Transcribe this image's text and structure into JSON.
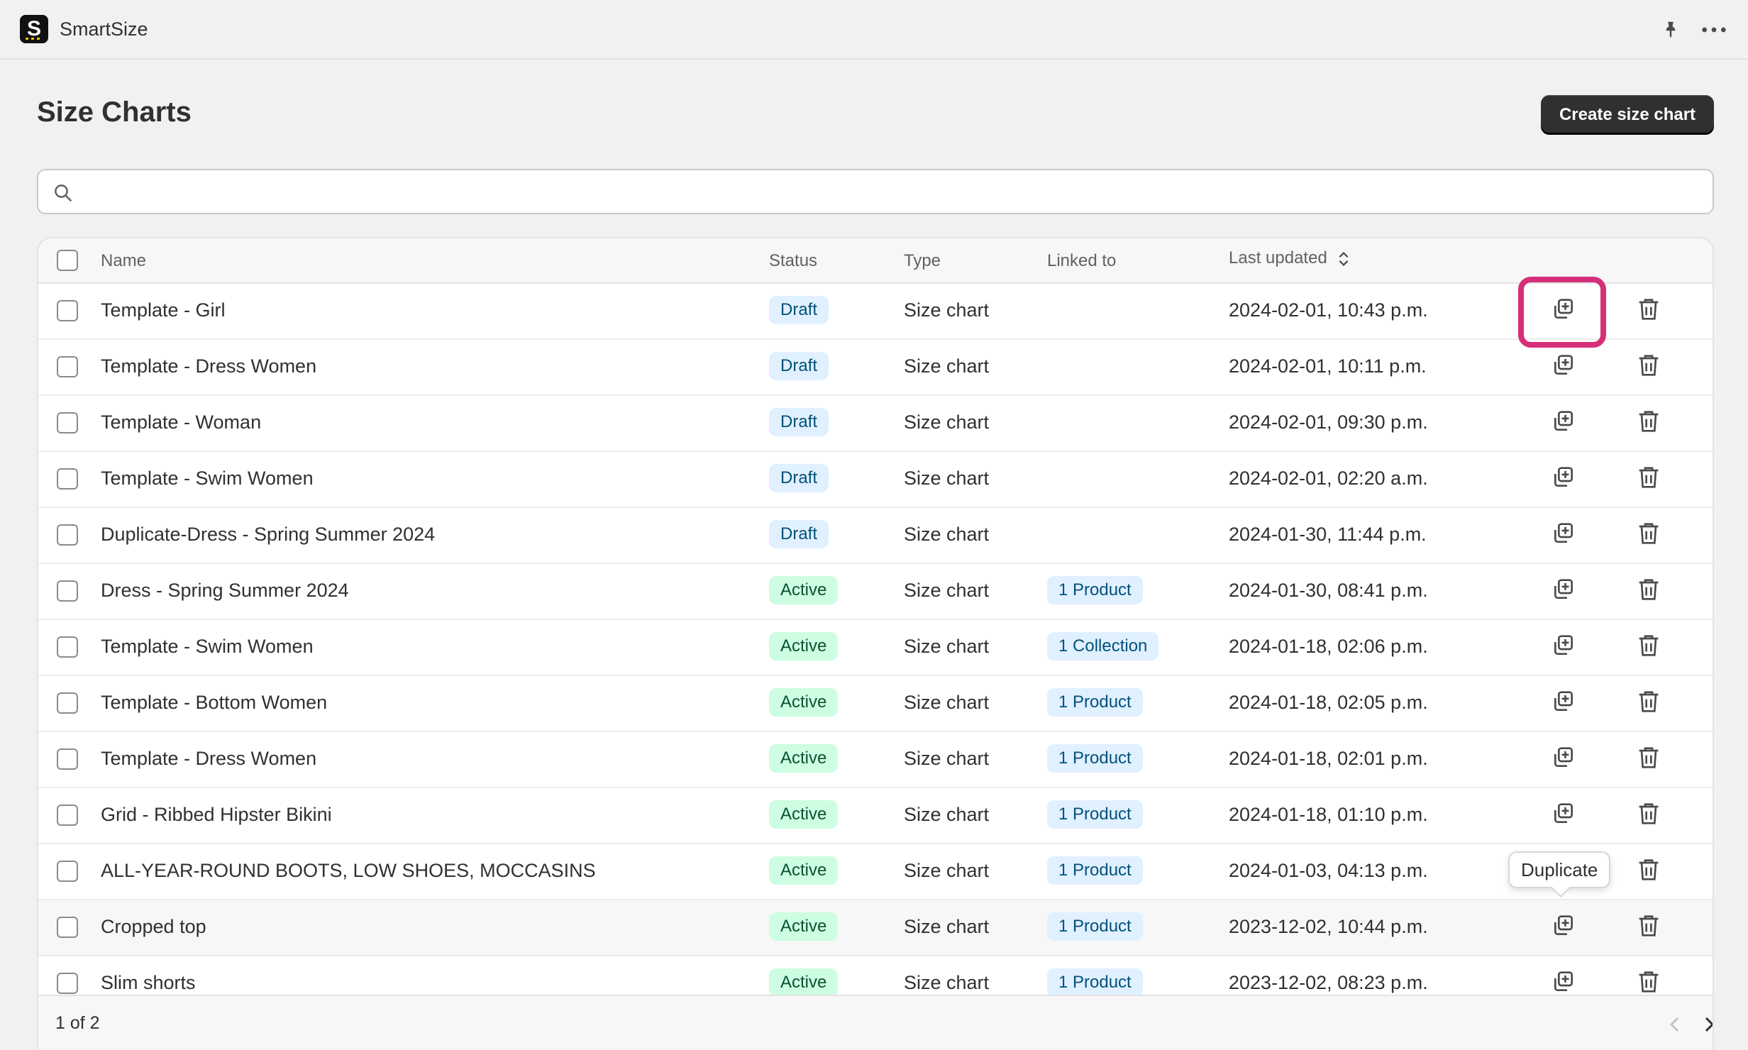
{
  "app": {
    "name": "SmartSize",
    "logo_letter": "S"
  },
  "topbar": {
    "pin_icon": "pin-icon",
    "more_icon": "more-horizontal-icon"
  },
  "page": {
    "title": "Size Charts",
    "create_button": "Create size chart"
  },
  "search": {
    "placeholder": "",
    "value": ""
  },
  "table": {
    "columns": {
      "name": "Name",
      "status": "Status",
      "type": "Type",
      "linked": "Linked to",
      "updated": "Last updated"
    },
    "rows": [
      {
        "name": "Template - Girl",
        "status": "Draft",
        "type": "Size chart",
        "linked": "",
        "updated": "2024-02-01, 10:43 p.m."
      },
      {
        "name": "Template - Dress Women",
        "status": "Draft",
        "type": "Size chart",
        "linked": "",
        "updated": "2024-02-01, 10:11 p.m."
      },
      {
        "name": "Template - Woman",
        "status": "Draft",
        "type": "Size chart",
        "linked": "",
        "updated": "2024-02-01, 09:30 p.m."
      },
      {
        "name": "Template - Swim Women",
        "status": "Draft",
        "type": "Size chart",
        "linked": "",
        "updated": "2024-02-01, 02:20 a.m."
      },
      {
        "name": "Duplicate-Dress - Spring Summer 2024",
        "status": "Draft",
        "type": "Size chart",
        "linked": "",
        "updated": "2024-01-30, 11:44 p.m."
      },
      {
        "name": "Dress - Spring Summer 2024",
        "status": "Active",
        "type": "Size chart",
        "linked": "1 Product",
        "updated": "2024-01-30, 08:41 p.m."
      },
      {
        "name": "Template - Swim Women",
        "status": "Active",
        "type": "Size chart",
        "linked": "1 Collection",
        "updated": "2024-01-18, 02:06 p.m."
      },
      {
        "name": "Template - Bottom Women",
        "status": "Active",
        "type": "Size chart",
        "linked": "1 Product",
        "updated": "2024-01-18, 02:05 p.m."
      },
      {
        "name": "Template - Dress Women",
        "status": "Active",
        "type": "Size chart",
        "linked": "1 Product",
        "updated": "2024-01-18, 02:01 p.m."
      },
      {
        "name": "Grid - Ribbed Hipster Bikini",
        "status": "Active",
        "type": "Size chart",
        "linked": "1 Product",
        "updated": "2024-01-18, 01:10 p.m."
      },
      {
        "name": "ALL-YEAR-ROUND BOOTS, LOW SHOES, MOCCASINS",
        "status": "Active",
        "type": "Size chart",
        "linked": "1 Product",
        "updated": "2024-01-03, 04:13 p.m."
      },
      {
        "name": "Cropped top",
        "status": "Active",
        "type": "Size chart",
        "linked": "1 Product",
        "updated": "2023-12-02, 10:44 p.m."
      },
      {
        "name": "Slim shorts",
        "status": "Active",
        "type": "Size chart",
        "linked": "1 Product",
        "updated": "2023-12-02, 08:23 p.m."
      }
    ]
  },
  "tooltip": {
    "text": "Duplicate"
  },
  "pagination": {
    "label": "1 of 2"
  },
  "colors": {
    "highlight": "#d62f7a",
    "draft_badge": "#e0f0ff",
    "active_badge": "#cdfee1",
    "primary_button": "#303030"
  }
}
